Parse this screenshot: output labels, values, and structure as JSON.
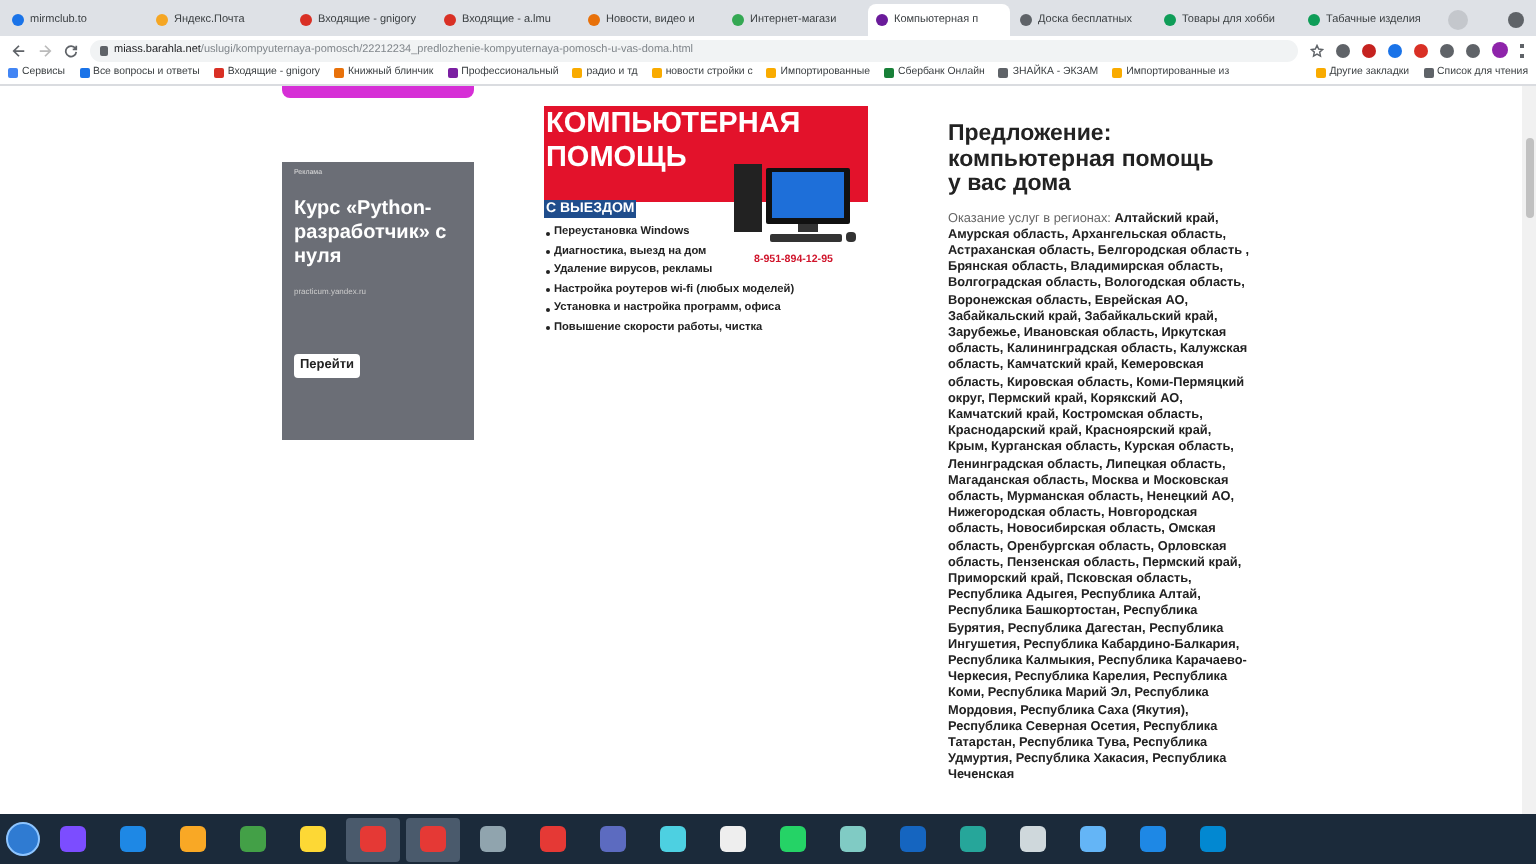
{
  "browser": {
    "tabs": [
      {
        "title": "mirmclub.to",
        "selected": false,
        "color": "#1a73e8"
      },
      {
        "title": "Яндекс.Почта",
        "selected": false,
        "color": "#f5a623"
      },
      {
        "title": "Входящие - gnigory",
        "selected": false,
        "color": "#d93025"
      },
      {
        "title": "Входящие - a.lmu",
        "selected": false,
        "color": "#d93025"
      },
      {
        "title": "Новости, видео и",
        "selected": false,
        "color": "#e8710a"
      },
      {
        "title": "Интернет-магази",
        "selected": false,
        "color": "#34a853"
      },
      {
        "title": "Компьютерная п",
        "selected": true,
        "color": "#6a1b9a"
      },
      {
        "title": "Доска бесплатных",
        "selected": false,
        "color": "#5f6368"
      },
      {
        "title": "Товары для хобби",
        "selected": false,
        "color": "#0f9d58"
      },
      {
        "title": "Табачные изделия",
        "selected": false,
        "color": "#0f9d58"
      }
    ],
    "url_host": "miass.barahla.net",
    "url_path": "/uslugi/kompyuternaya-pomosch/22212234_predlozhenie-kompyuternaya-pomosch-u-vas-doma.html",
    "bookmarks": [
      {
        "title": "Сервисы",
        "color": "#4285f4"
      },
      {
        "title": "Все вопросы и ответы",
        "color": "#1a73e8"
      },
      {
        "title": "Входящие - gnigory",
        "color": "#d93025"
      },
      {
        "title": "Книжный блинчик",
        "color": "#e8710a"
      },
      {
        "title": "Профессиональный",
        "color": "#7b1fa2"
      },
      {
        "title": "радио и тд",
        "color": "#f9ab00"
      },
      {
        "title": "новости стройки с",
        "color": "#f9ab00"
      },
      {
        "title": "Импортированные",
        "color": "#f9ab00"
      },
      {
        "title": "Сбербанк Онлайн",
        "color": "#188038"
      },
      {
        "title": "ЗНАЙКА - ЭКЗАМ",
        "color": "#5f6368"
      },
      {
        "title": "Импортированные из",
        "color": "#f9ab00"
      }
    ],
    "bookmarks_right": [
      {
        "title": "Другие закладки",
        "color": "#f9ab00"
      },
      {
        "title": "Список для чтения",
        "color": "#5f6368"
      }
    ]
  },
  "ad": {
    "label": "Реклама",
    "title": "Курс «Python-разработчик» с нуля",
    "domain": "practicum.yandex.ru",
    "button": "Перейти"
  },
  "banner": {
    "title": "КОМПЬЮТЕРНАЯ ПОМОЩЬ",
    "subtitle": "С ВЫЕЗДОМ",
    "phone": "8-951-894-12-95",
    "items": [
      "Переустановка Windows",
      "Диагностика, выезд на дом",
      "Удаление вирусов, рекламы",
      "Настройка роутеров wi-fi (любых моделей)",
      "Установка и настройка программ, офиса",
      "Повышение скорости работы, чистка"
    ]
  },
  "offer": {
    "heading": "Предложение: компьютерная помощь у вас дома",
    "text": "Оказание услуг в регионах: **Алтайский край, Амурская область, Архангельская область, Астраханская область, Белгородская область , Брянская область, Владимирская область, Волгоградская область, Вологодская область, Воронежская область, Еврейская АО, Забайкальский край, Забайкальский край, Зарубежье, Ивановская область, Иркутская область, Калининградская область, Калужская область, Камчатский край, Кемеровская область, Кировская область, Коми-Пермяцкий округ, Пермский край, Корякский АО, Камчатский край, Костромская область, Краснодарский край, Красноярский край, Крым, Курганская область, Курская область, Ленинградская область, Липецкая область, Магаданская область, Москва и Московская область, Мурманская область, Ненецкий АО, Нижегородская область, Новгородская область, Новосибирская область, Омская область, Оренбургская область, Орловская область, Пензенская область, Пермский край, Приморский край, Псковская область, Республика Адыгея, Республика Алтай, Республика Башкортостан, Республика Бурятия, Республика Дагестан, Республика Ингушетия, Республика Кабардино-Балкария, Республика Калмыкия, Республика Карачаево-Черкесия, Республика Карелия, Республика Коми, Республика Марий Эл, Республика Мордовия, Республика Саха (Якутия), Республика Северная Осетия, Республика Татарстан, Республика Тува, Республика Удмуртия, Республика Хакасия, Республика Чеченская**"
  },
  "taskbar": {
    "apps": [
      {
        "color": "#7c4dff",
        "active": false
      },
      {
        "color": "#1e88e5",
        "active": false
      },
      {
        "color": "#f9a825",
        "active": false
      },
      {
        "color": "#43a047",
        "active": false
      },
      {
        "color": "#fdd835",
        "active": false
      },
      {
        "color": "#e53935",
        "active": true
      },
      {
        "color": "#e53935",
        "active": true
      },
      {
        "color": "#90a4ae",
        "active": false
      },
      {
        "color": "#e53935",
        "active": false
      },
      {
        "color": "#5c6bc0",
        "active": false
      },
      {
        "color": "#4dd0e1",
        "active": false
      },
      {
        "color": "#eeeeee",
        "active": false
      },
      {
        "color": "#25d366",
        "active": false
      },
      {
        "color": "#80cbc4",
        "active": false
      },
      {
        "color": "#1565c0",
        "active": false
      },
      {
        "color": "#26a69a",
        "active": false
      },
      {
        "color": "#cfd8dc",
        "active": false
      },
      {
        "color": "#64b5f6",
        "active": false
      },
      {
        "color": "#1e88e5",
        "active": false
      },
      {
        "color": "#0288d1",
        "active": false
      }
    ]
  }
}
